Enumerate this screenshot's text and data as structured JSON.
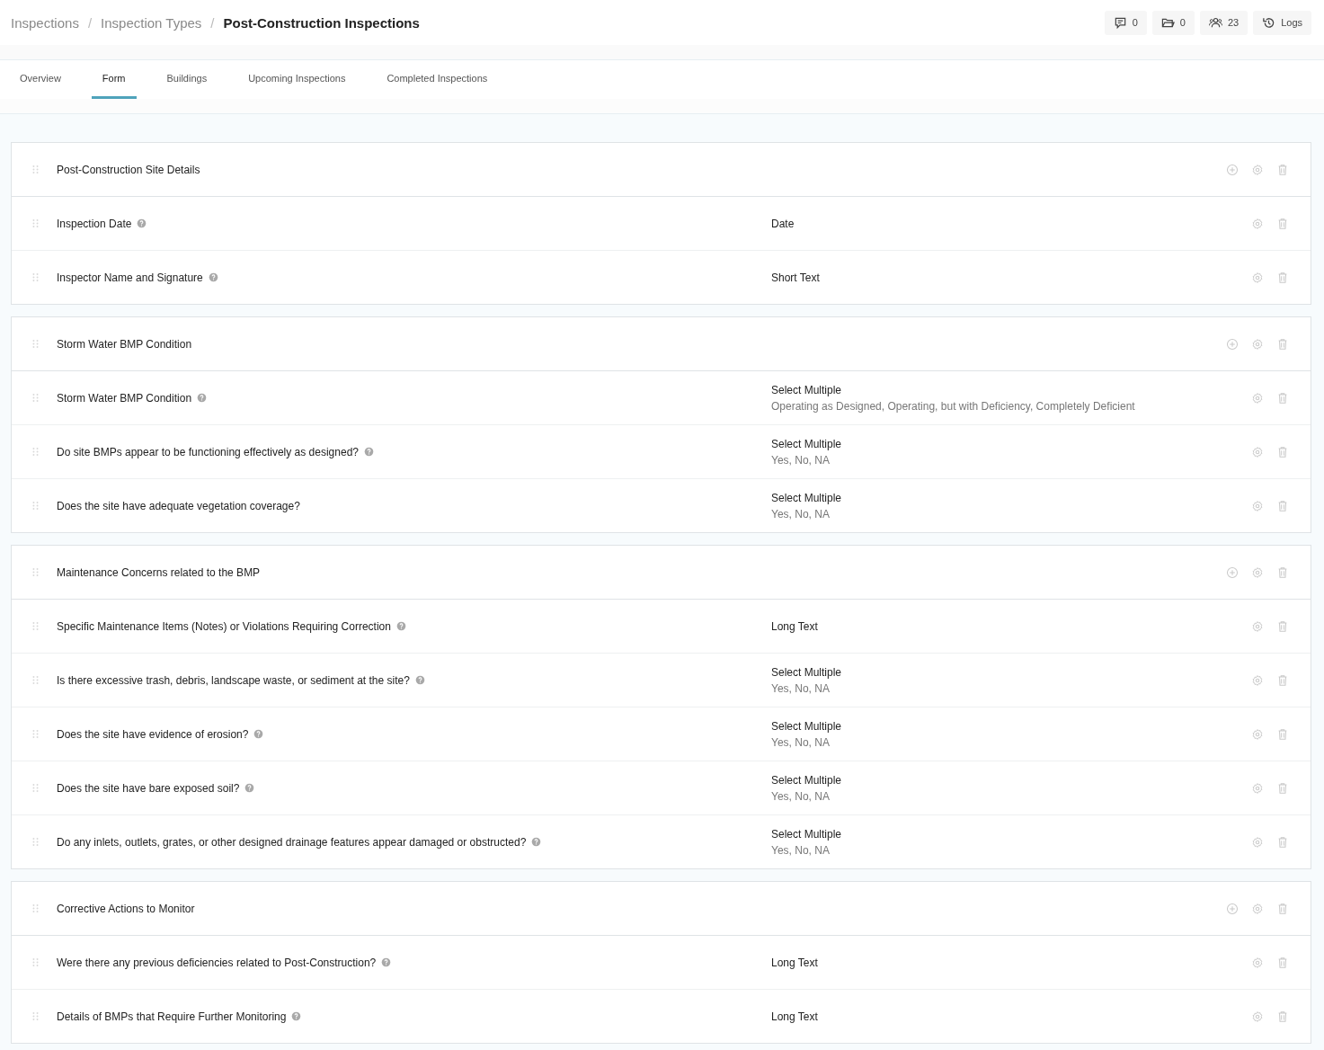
{
  "breadcrumb": [
    {
      "kind": "link",
      "label": "Inspections"
    },
    {
      "kind": "separator",
      "label": "/"
    },
    {
      "kind": "link",
      "label": "Inspection Types"
    },
    {
      "kind": "separator",
      "label": "/"
    },
    {
      "kind": "title",
      "label": "Post-Construction Inspections"
    }
  ],
  "header_buttons": [
    {
      "label": "0"
    },
    {
      "label": "0"
    },
    {
      "label": "23"
    },
    {
      "label": "Logs"
    }
  ],
  "tabs": [
    {
      "label": "Overview",
      "selected": false
    },
    {
      "label": "Form",
      "selected": true
    },
    {
      "label": "Buildings",
      "selected": false
    },
    {
      "label": "Upcoming Inspections",
      "selected": false
    },
    {
      "label": "Completed Inspections",
      "selected": false
    }
  ],
  "sections": [
    {
      "title": "Post-Construction Site Details",
      "fields": [
        {
          "label": "Inspection Date",
          "help": true,
          "type": "Date"
        },
        {
          "label": "Inspector Name and Signature",
          "help": true,
          "type": "Short Text"
        }
      ]
    },
    {
      "title": "Storm Water BMP Condition",
      "fields": [
        {
          "label": "Storm Water BMP Condition",
          "help": true,
          "type": "Select Multiple",
          "options": "Operating as Designed, Operating, but with Deficiency, Completely Deficient"
        },
        {
          "label": "Do site BMPs appear to be functioning effectively as designed?",
          "help": true,
          "type": "Select Multiple",
          "options": "Yes, No, NA"
        },
        {
          "label": "Does the site have adequate vegetation coverage?",
          "help": false,
          "type": "Select Multiple",
          "options": "Yes, No, NA"
        }
      ]
    },
    {
      "title": "Maintenance Concerns related to the BMP",
      "fields": [
        {
          "label": "Specific Maintenance Items (Notes) or Violations Requiring Correction",
          "help": true,
          "type": "Long Text"
        },
        {
          "label": "Is there excessive trash, debris, landscape waste, or sediment at the site?",
          "help": true,
          "type": "Select Multiple",
          "options": "Yes, No, NA"
        },
        {
          "label": "Does the site have evidence of erosion?",
          "help": true,
          "type": "Select Multiple",
          "options": "Yes, No, NA"
        },
        {
          "label": "Does the site have bare exposed soil?",
          "help": true,
          "type": "Select Multiple",
          "options": "Yes, No, NA"
        },
        {
          "label": "Do any inlets, outlets, grates, or other designed drainage features appear damaged or obstructed?",
          "help": true,
          "type": "Select Multiple",
          "options": "Yes, No, NA"
        }
      ]
    },
    {
      "title": "Corrective Actions to Monitor",
      "fields": [
        {
          "label": "Were there any previous deficiencies related to Post-Construction?",
          "help": true,
          "type": "Long Text"
        },
        {
          "label": "Details of BMPs that Require Further Monitoring",
          "help": true,
          "type": "Long Text"
        }
      ]
    }
  ]
}
